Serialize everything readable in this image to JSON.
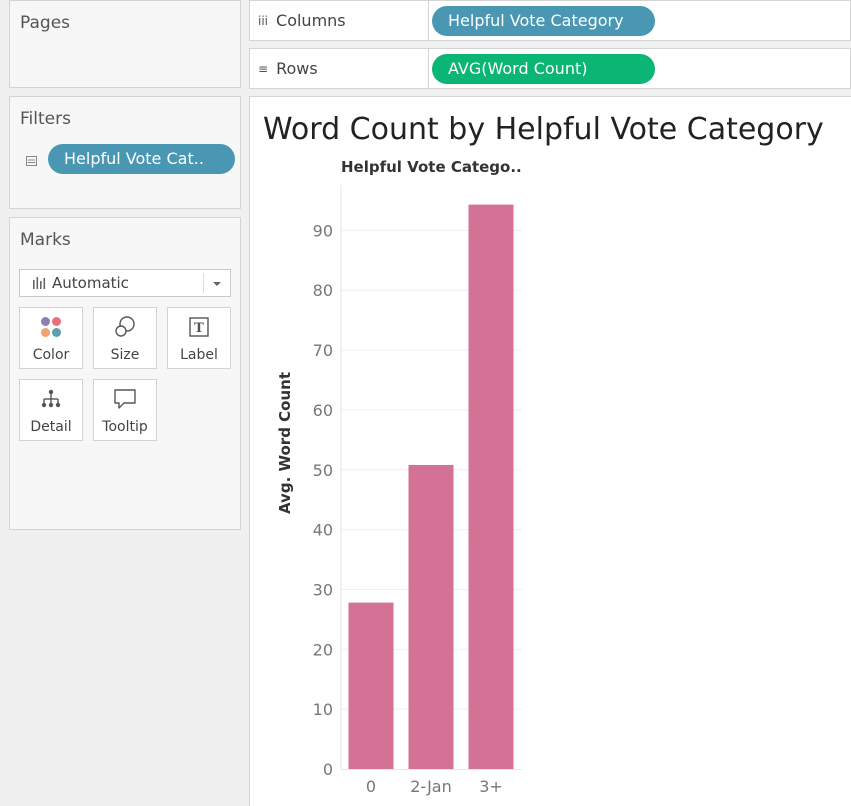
{
  "pages": {
    "title": "Pages"
  },
  "filters": {
    "title": "Filters",
    "pill": "Helpful Vote Cat.."
  },
  "marks": {
    "title": "Marks",
    "type": "Automatic",
    "buttons": [
      "Color",
      "Size",
      "Label",
      "Detail",
      "Tooltip"
    ]
  },
  "shelves": {
    "columns": {
      "label": "Columns",
      "pill": "Helpful Vote Category"
    },
    "rows": {
      "label": "Rows",
      "pill": "AVG(Word Count)"
    }
  },
  "colors": {
    "dimension_pill": "#4a97b4",
    "measure_pill": "#0bb573",
    "bar": "#d37295"
  },
  "chart_data": {
    "type": "bar",
    "title": "Word Count by Helpful Vote Category",
    "column_header": "Helpful Vote Catego..",
    "categories": [
      "0",
      "2-Jan",
      "3+"
    ],
    "values": [
      27.8,
      50.8,
      94.3
    ],
    "ylabel": "Avg. Word Count",
    "ylim": [
      0,
      100
    ],
    "yticks": [
      0,
      10,
      20,
      30,
      40,
      50,
      60,
      70,
      80,
      90
    ],
    "grid": true
  }
}
